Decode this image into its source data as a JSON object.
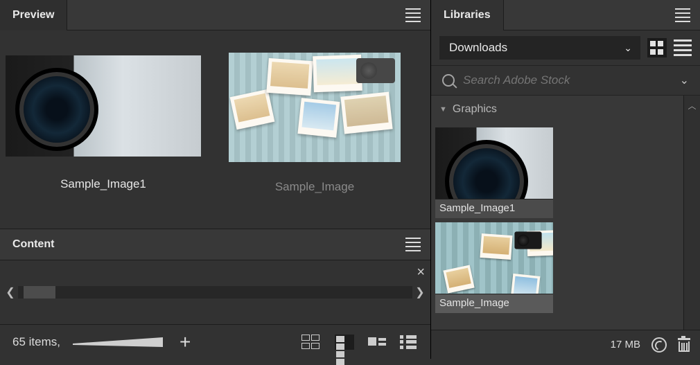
{
  "preview": {
    "tab_label": "Preview",
    "items": [
      {
        "caption": "Sample_Image1",
        "dim": false
      },
      {
        "caption": "Sample_Image",
        "dim": true
      }
    ]
  },
  "content": {
    "tab_label": "Content",
    "item_count_label": "65 items,"
  },
  "libraries": {
    "tab_label": "Libraries",
    "dropdown_selected": "Downloads",
    "search_placeholder": "Search Adobe Stock",
    "section_label": "Graphics",
    "items": [
      {
        "label": "Sample_Image1",
        "selected": false
      },
      {
        "label": "Sample_Image",
        "selected": true
      }
    ],
    "storage_label": "17 MB"
  }
}
